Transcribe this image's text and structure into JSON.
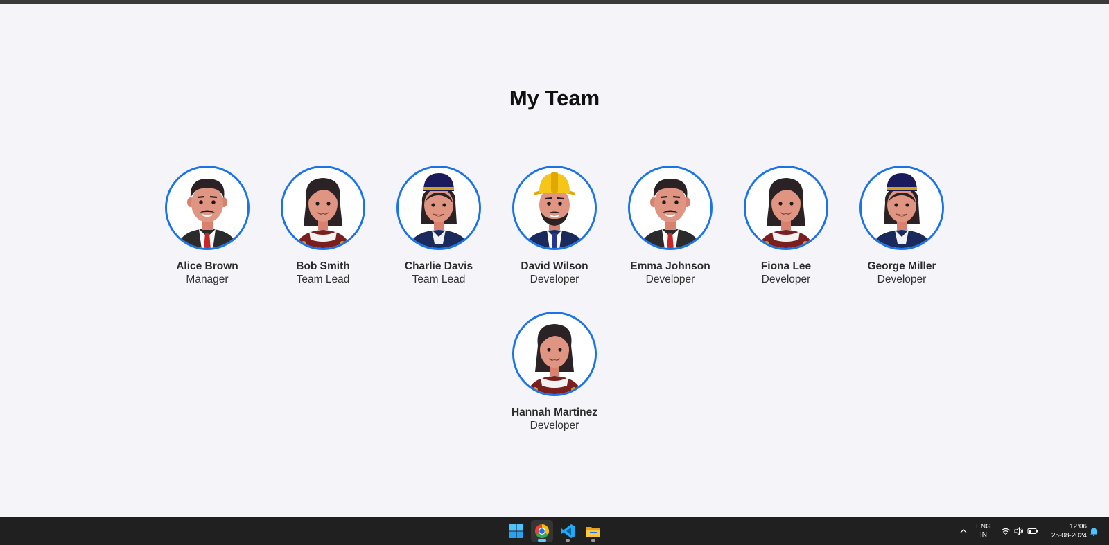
{
  "page": {
    "title": "My Team"
  },
  "team": [
    {
      "name": "Alice Brown",
      "role": "Manager",
      "avatar": "man-mustache-suit"
    },
    {
      "name": "Bob Smith",
      "role": "Team Lead",
      "avatar": "woman-dark-hair"
    },
    {
      "name": "Charlie Davis",
      "role": "Team Lead",
      "avatar": "woman-navy-cap"
    },
    {
      "name": "David Wilson",
      "role": "Developer",
      "avatar": "man-hard-hat-beard"
    },
    {
      "name": "Emma Johnson",
      "role": "Developer",
      "avatar": "man-mustache-suit"
    },
    {
      "name": "Fiona Lee",
      "role": "Developer",
      "avatar": "woman-dark-hair"
    },
    {
      "name": "George Miller",
      "role": "Developer",
      "avatar": "woman-navy-cap"
    },
    {
      "name": "Hannah Martinez",
      "role": "Developer",
      "avatar": "woman-dark-hair"
    }
  ],
  "taskbar": {
    "apps": [
      "windows-start-icon",
      "chrome-icon",
      "vscode-icon",
      "file-explorer-icon"
    ],
    "tray": {
      "lang_line1": "ENG",
      "lang_line2": "IN",
      "time": "12:06",
      "date": "25-08-2024",
      "icons": [
        "chevron-up-icon",
        "wifi-icon",
        "volume-icon",
        "battery-icon",
        "bell-icon"
      ]
    }
  },
  "colors": {
    "accent": "#1a73e8",
    "background": "#f4f4f9",
    "taskbar": "#202020"
  }
}
